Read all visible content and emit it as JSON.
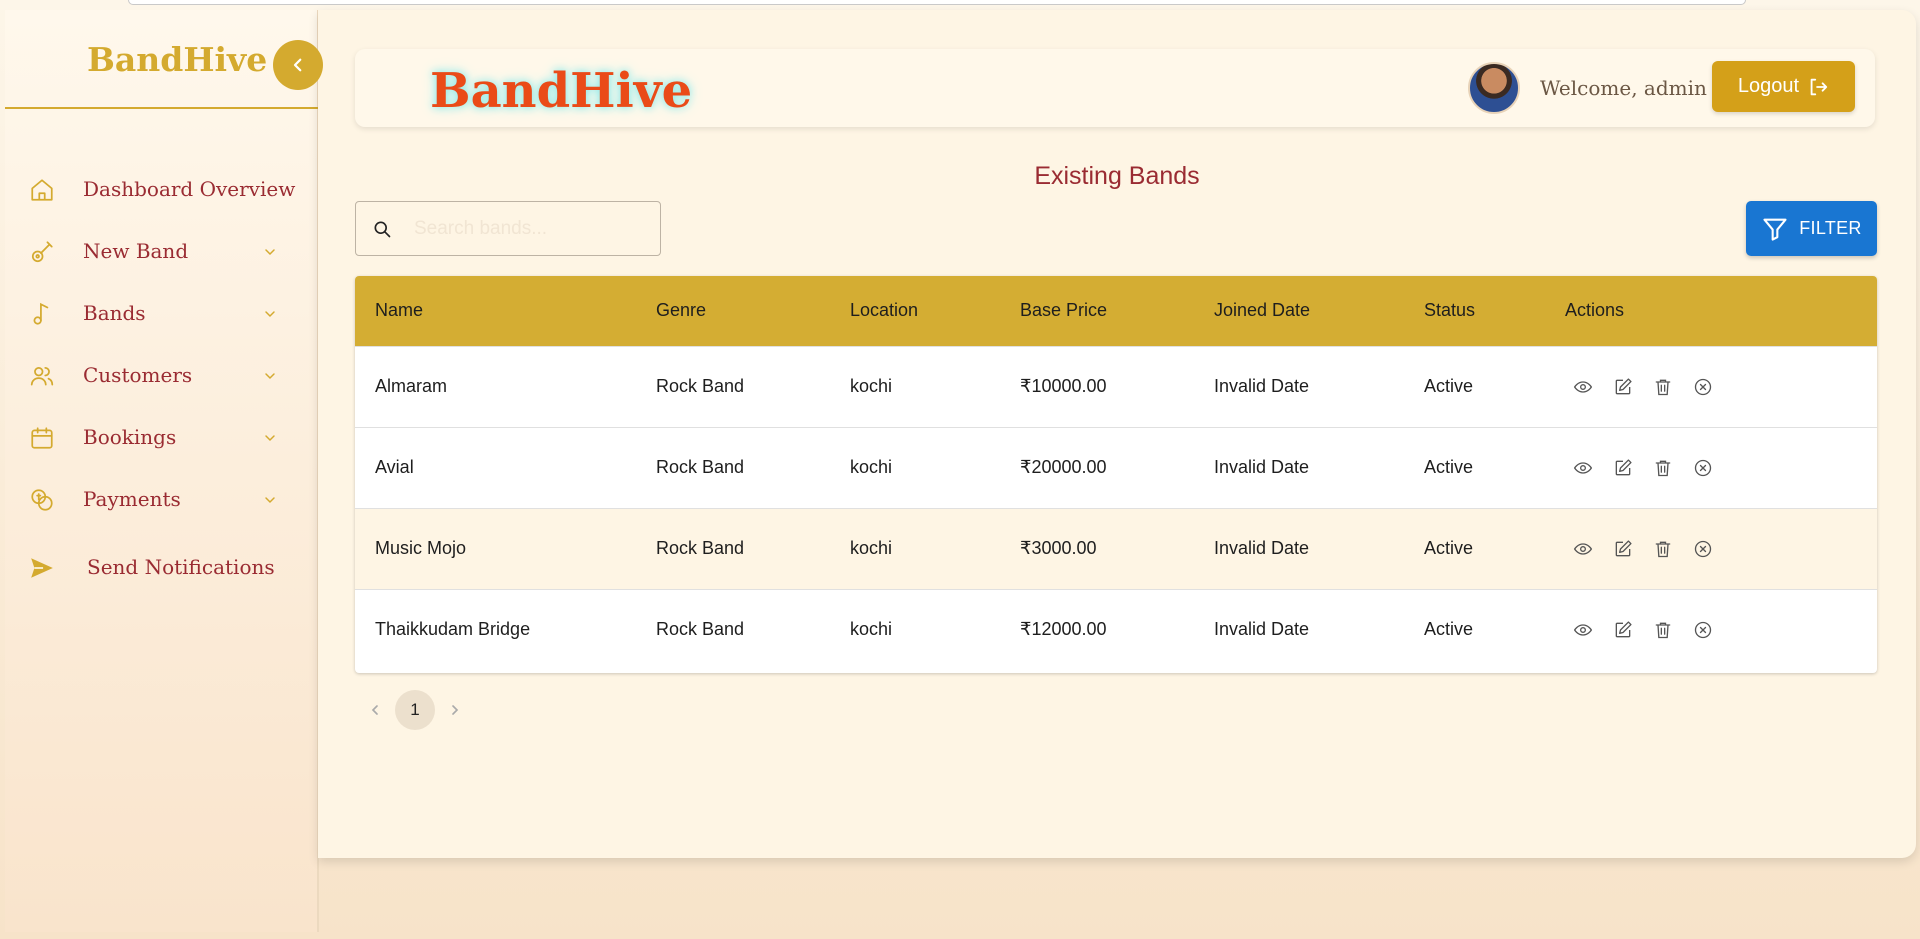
{
  "sidebar": {
    "brand": "BandHive",
    "items": [
      {
        "label": "Dashboard Overview",
        "icon": "home-icon",
        "has_submenu": false
      },
      {
        "label": "New Band",
        "icon": "guitar-icon",
        "has_submenu": true
      },
      {
        "label": "Bands",
        "icon": "music-note-icon",
        "has_submenu": true
      },
      {
        "label": "Customers",
        "icon": "users-icon",
        "has_submenu": true
      },
      {
        "label": "Bookings",
        "icon": "calendar-icon",
        "has_submenu": true
      },
      {
        "label": "Payments",
        "icon": "coins-icon",
        "has_submenu": true
      },
      {
        "label": "Send Notifications",
        "icon": "send-icon",
        "has_submenu": false
      }
    ]
  },
  "header": {
    "brand": "BandHive",
    "welcome": "Welcome, admin",
    "logout_label": "Logout"
  },
  "main": {
    "title": "Existing Bands",
    "search": {
      "placeholder": "Search bands...",
      "value": ""
    },
    "filter_label": "FILTER",
    "table": {
      "columns": [
        "Name",
        "Genre",
        "Location",
        "Base Price",
        "Joined Date",
        "Status",
        "Actions"
      ],
      "rows": [
        {
          "name": "Almaram",
          "genre": "Rock Band",
          "location": "kochi",
          "price": "₹10000.00",
          "joined": "Invalid Date",
          "status": "Active"
        },
        {
          "name": "Avial",
          "genre": "Rock Band",
          "location": "kochi",
          "price": "₹20000.00",
          "joined": "Invalid Date",
          "status": "Active"
        },
        {
          "name": "Music Mojo",
          "genre": "Rock Band",
          "location": "kochi",
          "price": "₹3000.00",
          "joined": "Invalid Date",
          "status": "Active"
        },
        {
          "name": "Thaikkudam Bridge",
          "genre": "Rock Band",
          "location": "kochi",
          "price": "₹12000.00",
          "joined": "Invalid Date",
          "status": "Active"
        }
      ]
    },
    "pagination": {
      "current_page": "1"
    }
  },
  "colors": {
    "gold": "#d4aa2f",
    "maroon": "#9a2b32",
    "brand_orange": "#ea4b18",
    "filter_blue": "#1976d2"
  }
}
